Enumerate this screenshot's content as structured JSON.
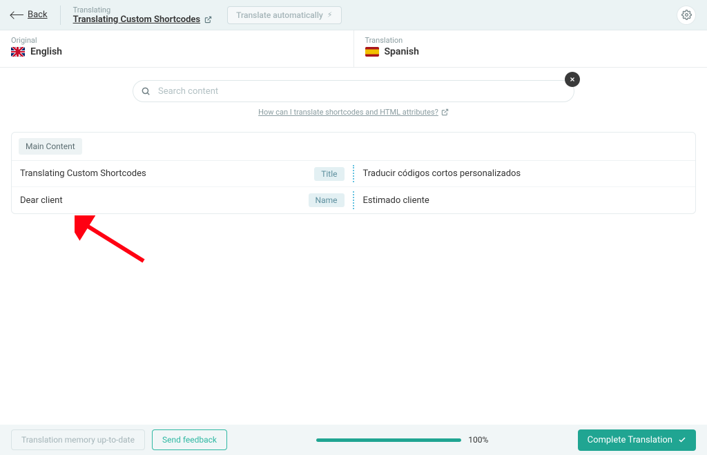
{
  "header": {
    "back_label": "Back",
    "breadcrumb_top": "Translating",
    "breadcrumb_title": "Translating Custom Shortcodes",
    "auto_btn": "Translate automatically"
  },
  "languages": {
    "original_label": "Original",
    "original_name": "English",
    "translation_label": "Translation",
    "translation_name": "Spanish"
  },
  "search": {
    "placeholder": "Search content",
    "help_link": "How can I translate shortcodes and HTML attributes?"
  },
  "panel": {
    "header": "Main Content",
    "rows": [
      {
        "src": "Translating Custom Shortcodes",
        "tag": "Title",
        "tgt": "Traducir códigos cortos personalizados"
      },
      {
        "src": "Dear client",
        "tag": "Name",
        "tgt": "Estimado cliente"
      }
    ]
  },
  "footer": {
    "memory_btn": "Translation memory up-to-date",
    "feedback_btn": "Send feedback",
    "progress_pct": "100%",
    "complete_btn": "Complete Translation"
  }
}
